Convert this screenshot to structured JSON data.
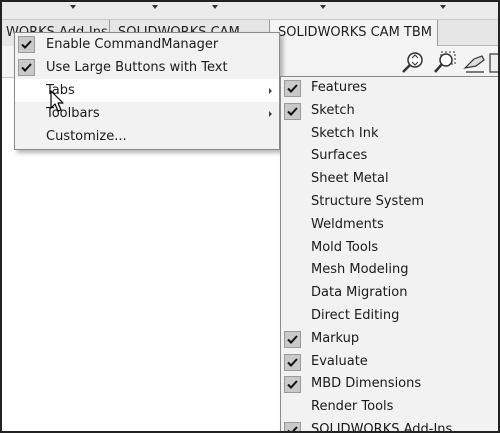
{
  "commandmanager": {
    "tabs": [
      {
        "label": "WORKS Add-Ins"
      },
      {
        "label": "SOLIDWORKS CAM"
      },
      {
        "label": "SOLIDWORKS CAM TBM"
      }
    ]
  },
  "context_menu": {
    "items": [
      {
        "label": "Enable CommandManager",
        "checked": true
      },
      {
        "label": "Use Large Buttons with Text",
        "checked": true
      },
      {
        "label": "Tabs",
        "has_submenu": true,
        "highlighted": true
      },
      {
        "label": "Toolbars",
        "has_submenu": true
      },
      {
        "label": "Customize..."
      }
    ]
  },
  "tabs_submenu": {
    "items": [
      {
        "label": "Features",
        "checked": true
      },
      {
        "label": "Sketch",
        "checked": true
      },
      {
        "label": "Sketch Ink",
        "checked": false
      },
      {
        "label": "Surfaces",
        "checked": false
      },
      {
        "label": "Sheet Metal",
        "checked": false
      },
      {
        "label": "Structure System",
        "checked": false
      },
      {
        "label": "Weldments",
        "checked": false
      },
      {
        "label": "Mold Tools",
        "checked": false
      },
      {
        "label": "Mesh Modeling",
        "checked": false
      },
      {
        "label": "Data Migration",
        "checked": false
      },
      {
        "label": "Direct Editing",
        "checked": false
      },
      {
        "label": "Markup",
        "checked": true
      },
      {
        "label": "Evaluate",
        "checked": true
      },
      {
        "label": "MBD Dimensions",
        "checked": true
      },
      {
        "label": "Render Tools",
        "checked": false
      },
      {
        "label": "SOLIDWORKS Add-Ins",
        "checked": true
      }
    ]
  }
}
